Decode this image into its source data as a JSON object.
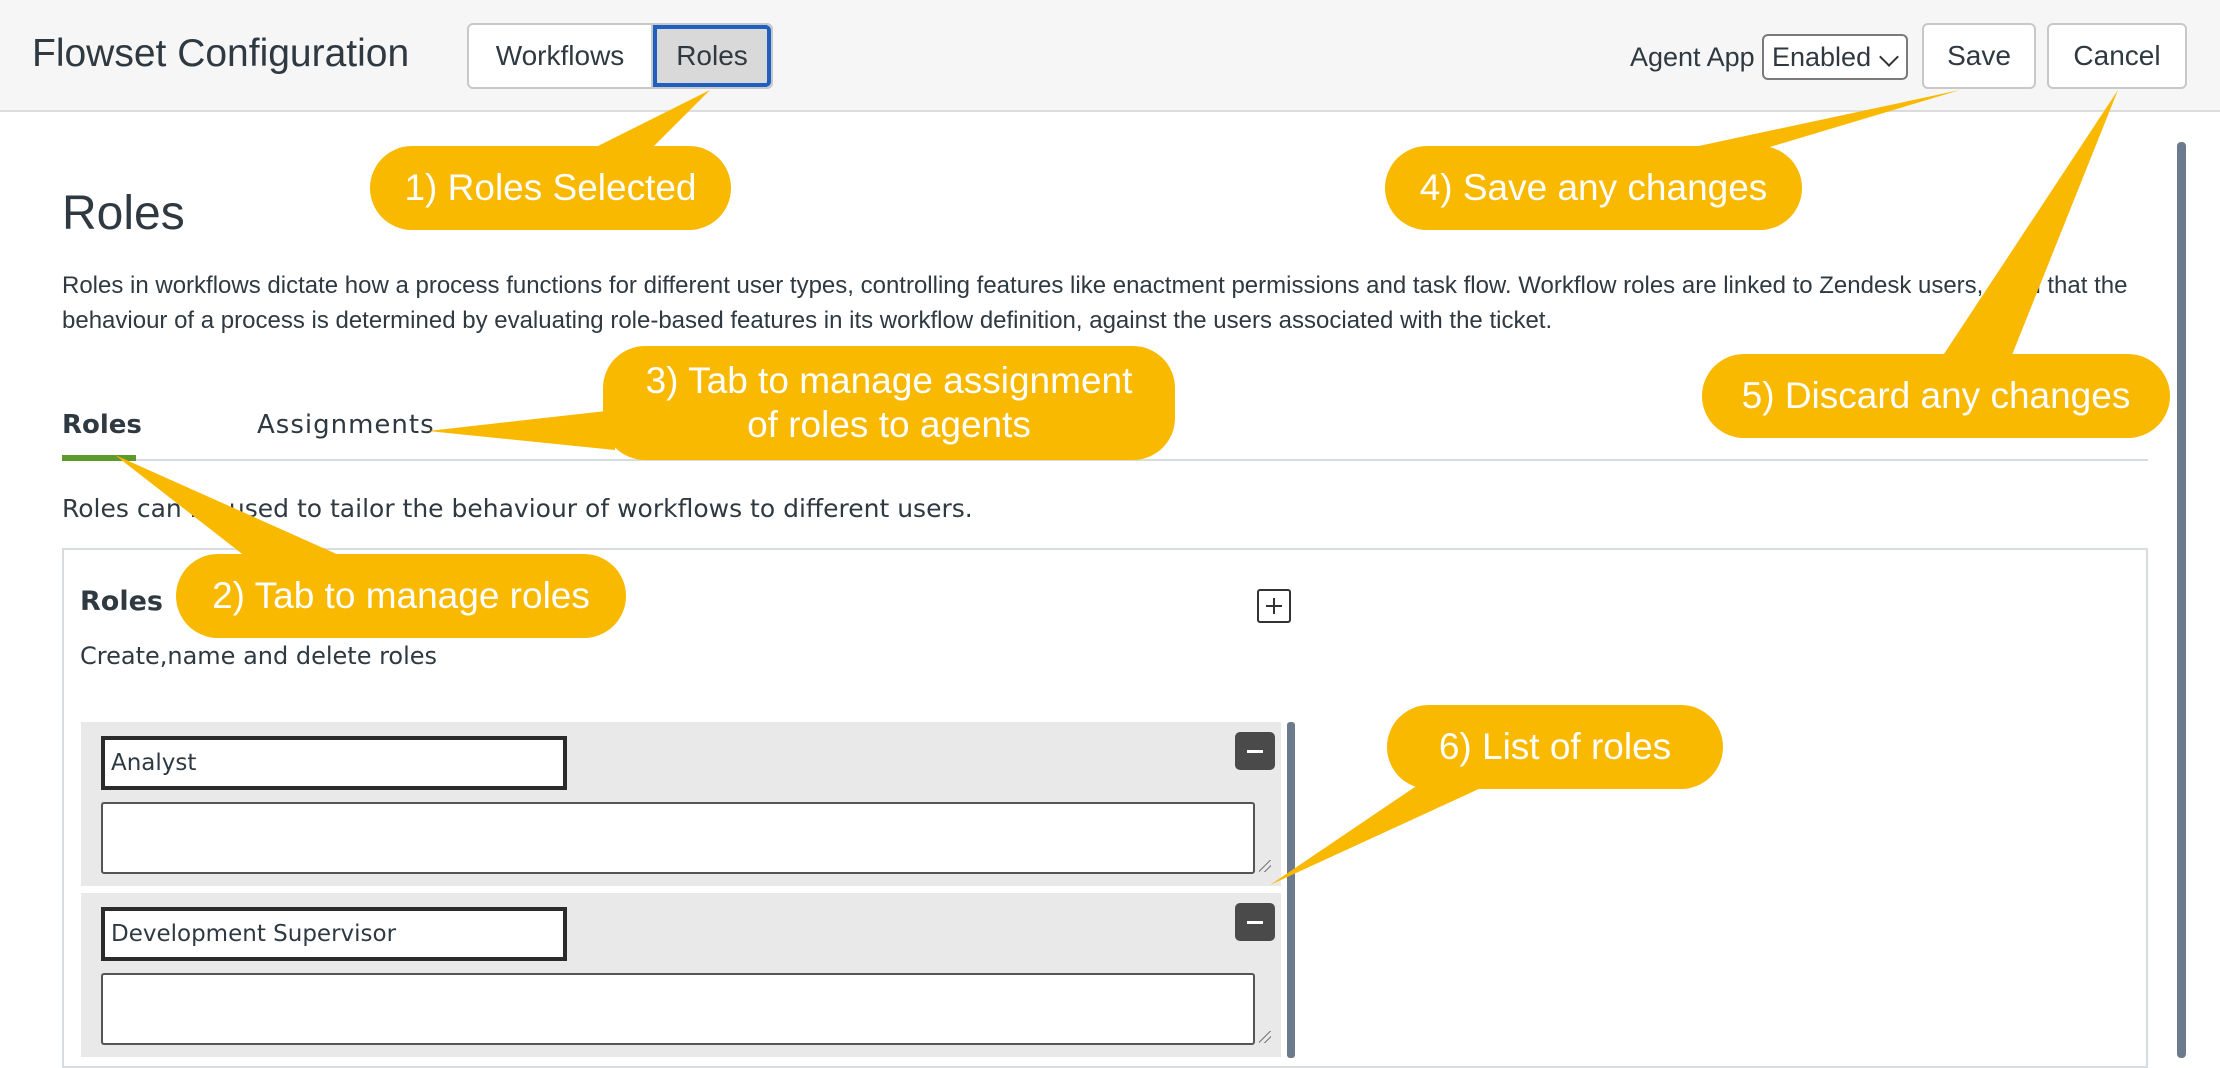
{
  "header": {
    "title": "Flowset Configuration",
    "tabs": [
      {
        "label": "Workflows"
      },
      {
        "label": "Roles"
      }
    ],
    "agent_app_label": "Agent App",
    "agent_app_value": "Enabled",
    "save_label": "Save",
    "cancel_label": "Cancel"
  },
  "content": {
    "heading": "Roles",
    "intro": "Roles in workflows dictate how a process functions for different user types, controlling features like enactment permissions and task flow. Workflow roles are linked to Zendesk users, such that the behaviour of a process is determined by evaluating role-based features in its workflow definition, against the users associated with the ticket.",
    "tabs": [
      {
        "label": "Roles"
      },
      {
        "label": "Assignments"
      }
    ],
    "tab_description": "Roles can be used to tailor the behaviour of workflows to different users."
  },
  "roles_panel": {
    "title": "Roles",
    "description": "Create,name and delete roles",
    "roles": [
      {
        "name": "Analyst",
        "description": ""
      },
      {
        "name": "Development Supervisor",
        "description": ""
      }
    ]
  },
  "callouts": [
    {
      "text": "1) Roles Selected"
    },
    {
      "text": "2) Tab to manage roles"
    },
    {
      "text": "3) Tab to manage assignment of roles to agents"
    },
    {
      "text": "4) Save any changes"
    },
    {
      "text": "5) Discard any changes"
    },
    {
      "text": "6) List of roles"
    }
  ],
  "colors": {
    "callout": "#f9b900",
    "active_tab_underline": "#5e9a2b",
    "selected_segment_ring": "#1f5fbf"
  }
}
